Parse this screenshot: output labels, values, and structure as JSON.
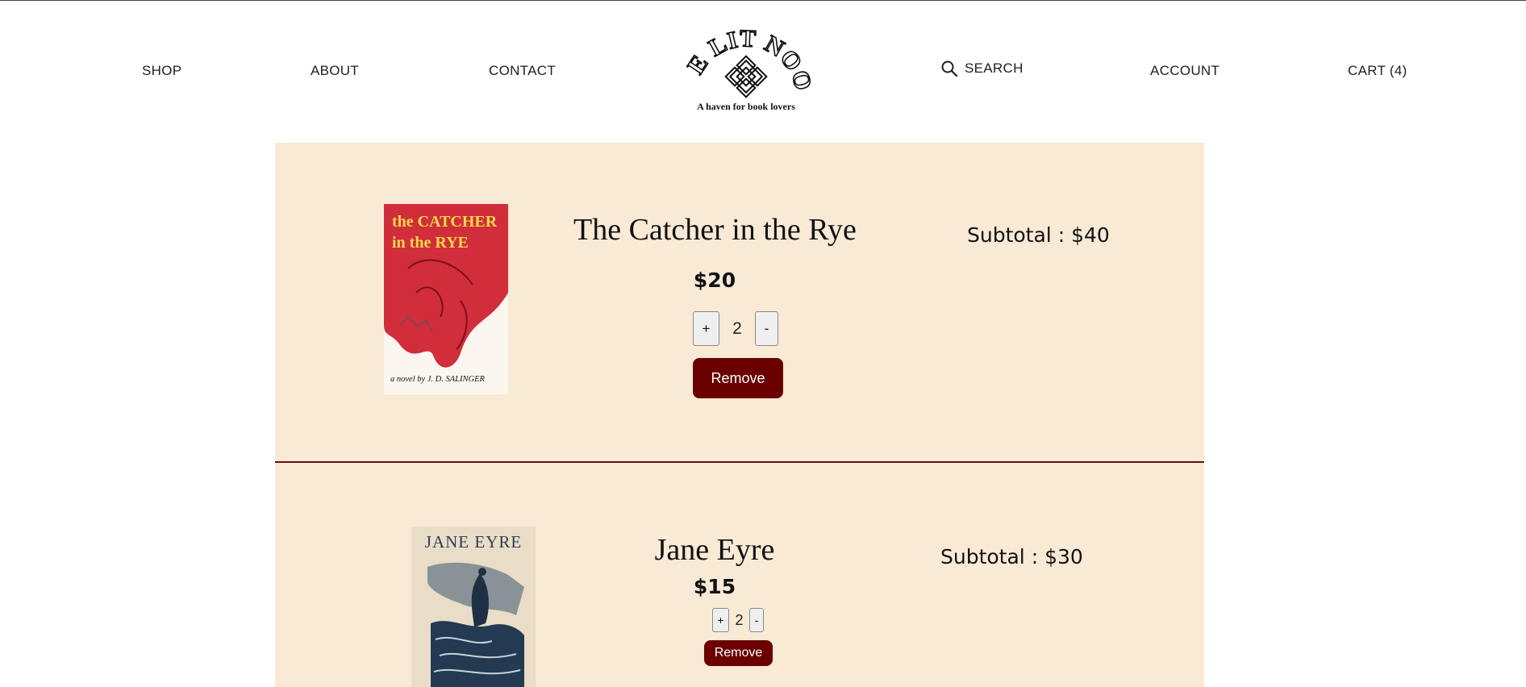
{
  "nav": {
    "shop": "SHOP",
    "about": "ABOUT",
    "contact": "CONTACT",
    "search": "SEARCH",
    "account": "ACCOUNT",
    "cart": "CART (4)"
  },
  "logo": {
    "name": "THE LIT NOOK",
    "tagline": "A haven for book lovers"
  },
  "cart_items": [
    {
      "title": "The Catcher in the Rye",
      "price": "$20",
      "quantity": "2",
      "plus_label": "+",
      "minus_label": "-",
      "remove_label": "Remove",
      "subtotal": "Subtotal : $40",
      "cover": {
        "line1": "the CATCHER",
        "line2": "in the RYE",
        "byline": "a novel by J. D. SALINGER"
      }
    },
    {
      "title": "Jane Eyre",
      "price": "$15",
      "quantity": "2",
      "plus_label": "+",
      "minus_label": "-",
      "remove_label": "Remove",
      "subtotal": "Subtotal : $30",
      "cover": {
        "line1": "JANE EYRE"
      }
    }
  ],
  "colors": {
    "panel_bg": "#f9ead6",
    "accent": "#6b0000",
    "divider": "#6b0a15"
  }
}
